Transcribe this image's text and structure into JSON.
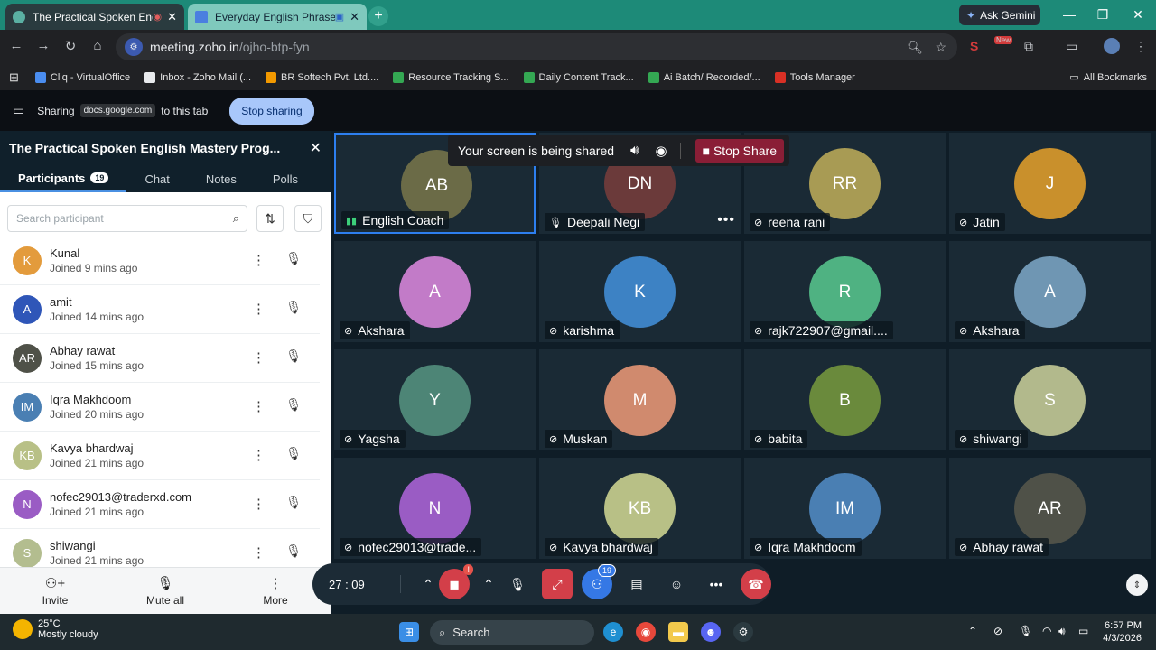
{
  "browser": {
    "tabs": [
      {
        "title": "The Practical Spoken English",
        "active": true
      },
      {
        "title": "Everyday English Phrases -",
        "active": false
      }
    ],
    "gemini_label": "Ask Gemini",
    "url_host": "meeting.zoho.in",
    "url_path": "/ojho-btp-fyn",
    "new_badge": "New",
    "bookmarks": [
      {
        "label": "Cliq - VirtualOffice",
        "color": "#4a8df0"
      },
      {
        "label": "Inbox - Zoho Mail (...",
        "color": "#e8eaed"
      },
      {
        "label": "BR Softech Pvt. Ltd....",
        "color": "#f29900"
      },
      {
        "label": "Resource Tracking S...",
        "color": "#34a853"
      },
      {
        "label": "Daily Content Track...",
        "color": "#34a853"
      },
      {
        "label": "Ai Batch/ Recorded/...",
        "color": "#34a853"
      },
      {
        "label": "Tools Manager",
        "color": "#d93025"
      }
    ],
    "all_bookmarks": "All Bookmarks"
  },
  "sharebar": {
    "sharing": "Sharing",
    "domain": "docs.google.com",
    "suffix": "to this tab",
    "stop_button": "Stop sharing"
  },
  "panel": {
    "title": "The Practical Spoken English Mastery Prog...",
    "tabs": [
      "Participants",
      "Chat",
      "Notes",
      "Polls"
    ],
    "participant_count": "19",
    "search_placeholder": "Search participant",
    "participants": [
      {
        "initials": "K",
        "name": "Kunal",
        "joined": "Joined 9 mins ago",
        "color": "#e39b3c"
      },
      {
        "initials": "A",
        "name": "amit",
        "joined": "Joined 14 mins ago",
        "color": "#2f56b8"
      },
      {
        "initials": "AR",
        "name": "Abhay rawat",
        "joined": "Joined 15 mins ago",
        "color": "#4f5148"
      },
      {
        "initials": "IM",
        "name": "Iqra Makhdoom",
        "joined": "Joined 20 mins ago",
        "color": "#4a7fb3"
      },
      {
        "initials": "KB",
        "name": "Kavya bhardwaj",
        "joined": "Joined 21 mins ago",
        "color": "#b8c086"
      },
      {
        "initials": "N",
        "name": "nofec29013@traderxd.com",
        "joined": "Joined 21 mins ago",
        "color": "#9a5cc4"
      },
      {
        "initials": "S",
        "name": "shiwangi",
        "joined": "Joined 21 mins ago",
        "color": "#b3bd8f"
      }
    ],
    "footer": {
      "invite": "Invite",
      "mute_all": "Mute all",
      "more": "More"
    }
  },
  "share_notice": {
    "text": "Your screen is being shared",
    "stop": "Stop Share"
  },
  "tiles": [
    {
      "initials": "AB",
      "name": "English Coach",
      "color": "#6b6b47",
      "speaking": true
    },
    {
      "initials": "DN",
      "name": "Deepali Negi",
      "color": "#6b3a3a",
      "mic_on": true
    },
    {
      "initials": "RR",
      "name": "reena rani",
      "color": "#a89b54"
    },
    {
      "initials": "J",
      "name": "Jatin",
      "color": "#c9902c"
    },
    {
      "initials": "A",
      "name": "Akshara",
      "color": "#c27bc8"
    },
    {
      "initials": "K",
      "name": "karishma",
      "color": "#3d82c4"
    },
    {
      "initials": "R",
      "name": "rajk722907@gmail....",
      "color": "#4fb282"
    },
    {
      "initials": "A",
      "name": "Akshara",
      "color": "#6f96b3"
    },
    {
      "initials": "Y",
      "name": "Yagsha",
      "color": "#4d8576"
    },
    {
      "initials": "M",
      "name": "Muskan",
      "color": "#d08a6e"
    },
    {
      "initials": "B",
      "name": "babita",
      "color": "#6a8a3c"
    },
    {
      "initials": "S",
      "name": "shiwangi",
      "color": "#b2b98c"
    },
    {
      "initials": "N",
      "name": "nofec29013@trade...",
      "color": "#9a5cc4"
    },
    {
      "initials": "KB",
      "name": "Kavya bhardwaj",
      "color": "#b8c086"
    },
    {
      "initials": "IM",
      "name": "Iqra Makhdoom",
      "color": "#4a7fb3"
    },
    {
      "initials": "AR",
      "name": "Abhay rawat",
      "color": "#4f5148"
    }
  ],
  "callbar": {
    "timer": "27 : 09",
    "video_badge": "!",
    "participants_badge": "19"
  },
  "taskbar": {
    "temp": "25°C",
    "weather": "Mostly cloudy",
    "search": "Search",
    "time": "6:57 PM",
    "date": "4/3/2026"
  }
}
